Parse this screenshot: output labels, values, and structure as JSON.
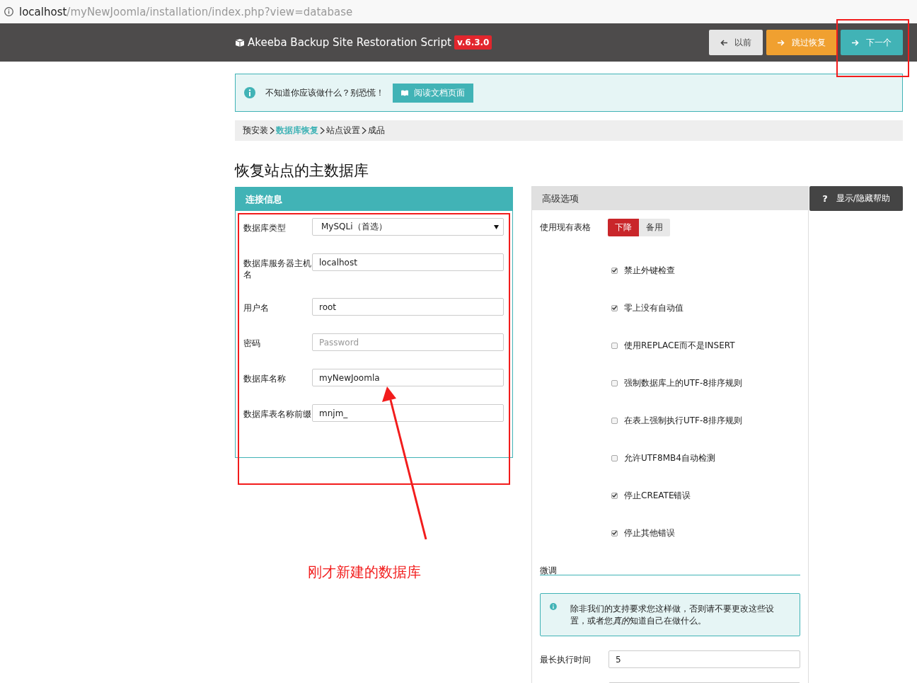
{
  "address_bar": {
    "host": "localhost",
    "path": "/myNewJoomla/installation/index.php?view=database"
  },
  "header": {
    "title": "Akeeba Backup Site Restoration Script",
    "version": "v.6.3.0",
    "buttons": [
      {
        "label": "以前",
        "kind": "default"
      },
      {
        "label": "跳过恢复",
        "kind": "warning"
      },
      {
        "label": "下一个",
        "kind": "primary"
      }
    ]
  },
  "notice": {
    "text": "不知道你应该做什么？别恐慌！",
    "button": "阅读文档页面"
  },
  "breadcrumb": [
    {
      "label": "预安装",
      "selected": false
    },
    {
      "label": "数据库恢复",
      "selected": true
    },
    {
      "label": "站点设置",
      "selected": false
    },
    {
      "label": "成品",
      "selected": false
    }
  ],
  "page_title": "恢复站点的主数据库",
  "help_button": {
    "glyph": "?",
    "label": "显示/隐藏帮助"
  },
  "connection": {
    "title": "连接信息",
    "fields": [
      {
        "label": "数据库类型",
        "kind": "select",
        "value": "MySQLi（首选）"
      },
      {
        "label": "数据库服务器主机名",
        "kind": "text",
        "value": "localhost"
      },
      {
        "label": "用户名",
        "kind": "text",
        "value": "root"
      },
      {
        "label": "密码",
        "kind": "text",
        "placeholder": "Password"
      },
      {
        "label": "数据库名称",
        "kind": "text",
        "value": "myNewJoomla"
      },
      {
        "label": "数据库表名称前缀",
        "kind": "text",
        "value": "mnjm_"
      }
    ]
  },
  "advanced": {
    "title": "高级选项",
    "existing_tables": {
      "label": "使用现有表格",
      "options": [
        {
          "label": "下降",
          "selected": true
        },
        {
          "label": "备用",
          "selected": false
        }
      ]
    },
    "options": [
      {
        "label": "禁止外键检查",
        "checked": true
      },
      {
        "label": "零上没有自动值",
        "checked": true
      },
      {
        "label": "使用REPLACE而不是INSERT",
        "checked": false
      },
      {
        "label": "强制数据库上的UTF-8排序规则",
        "checked": false
      },
      {
        "label": "在表上强制执行UTF-8排序规则",
        "checked": false
      },
      {
        "label": "允许UTF8MB4自动检测",
        "checked": false
      },
      {
        "label": "停止CREATE错误",
        "checked": true
      },
      {
        "label": "停止其他错误",
        "checked": true
      }
    ],
    "fine_tuning": {
      "title": "微调",
      "info": [
        "除非我们的支持要求您这样做，否则请不要更改这些设置，或者您",
        "真的",
        "知道自己在做什么。"
      ],
      "fields": [
        {
          "label": "最长执行时间",
          "value": "5"
        }
      ]
    }
  },
  "annotation": {
    "caption": "刚才新建的数据库"
  }
}
